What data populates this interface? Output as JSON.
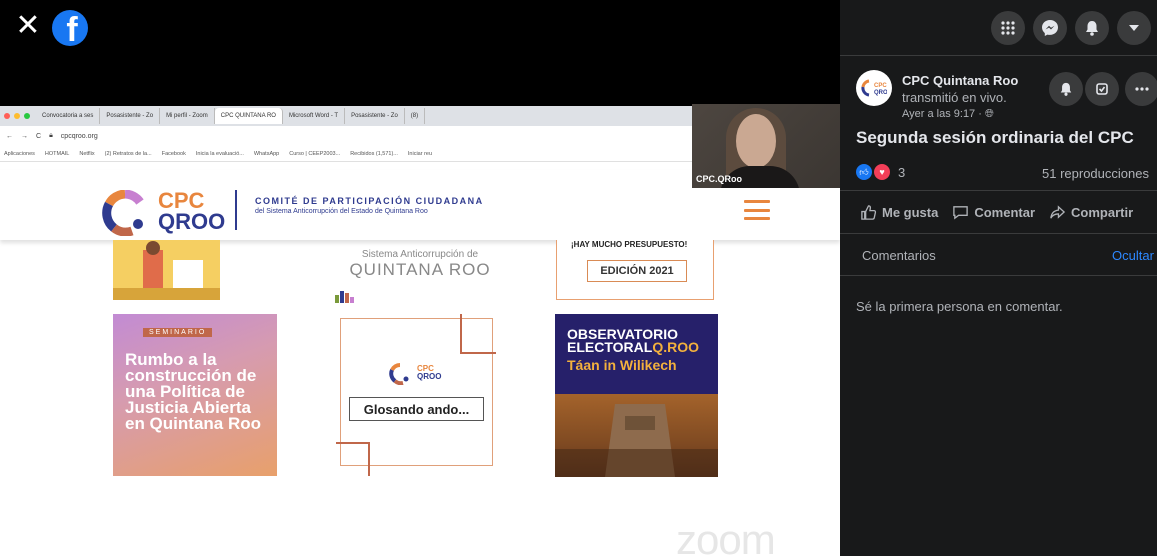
{
  "video": {
    "browser": {
      "tabs": [
        "Convocatoria a ses",
        "Posasistente - Zo",
        "Mi perfil - Zoom",
        "CPC QUINTANA RO",
        "Microsoft Word - T",
        "Posasistente - Zo",
        "(8)"
      ],
      "address": "cpcqroo.org",
      "bookmarks": [
        "Aplicaciones",
        "HOTMAIL",
        "Netflix",
        "(2) Retratos de la...",
        "Facebook",
        "Inicia la evaluació...",
        "WhatsApp",
        "Curso | CEEP2003...",
        "Recibidos (1,571)...",
        "Iniciar reu"
      ]
    },
    "site": {
      "logo_line1": "CPC",
      "logo_line2": "QROO",
      "comite": "COMITÉ DE PARTICIPACIÓN CIUDADANA",
      "comite_sub": "del Sistema Anticorrupción del Estado de Quintana Roo",
      "sistema_l1": "Sistema Anticorrupción de",
      "sistema_l2": "QUINTANA ROO",
      "presupuesto": "¡HAY MUCHO PRESUPUESTO!",
      "edicion": "EDICIÓN 2021",
      "seminario_badge": "SEMINARIO",
      "seminario_title": "Rumbo a la construcción de una Política de Justicia Abierta en Quintana Roo",
      "glosando_cpc": "CPC",
      "glosando_qroo": "QROO",
      "glosando_title": "Glosando ando...",
      "obs_title1": "OBSERVATORIO",
      "obs_title2": "ELECTORAL",
      "obs_title2b": "Q.ROO",
      "obs_sub": "Táan in Wilikech"
    },
    "zoom_watermark": "zoom",
    "webcam_label": "CPC.QRoo"
  },
  "panel": {
    "page_name": "CPC Quintana Roo",
    "action": "transmitió en vivo.",
    "time": "Ayer a las 9:17 · ",
    "title": "Segunda sesión ordinaria del CPC",
    "reaction_count": "3",
    "views": "51 reproducciones",
    "like": "Me gusta",
    "comment": "Comentar",
    "share": "Compartir",
    "comments_tab": "Comentarios",
    "hide": "Ocultar",
    "first_comment": "Sé la primera persona en comentar."
  }
}
